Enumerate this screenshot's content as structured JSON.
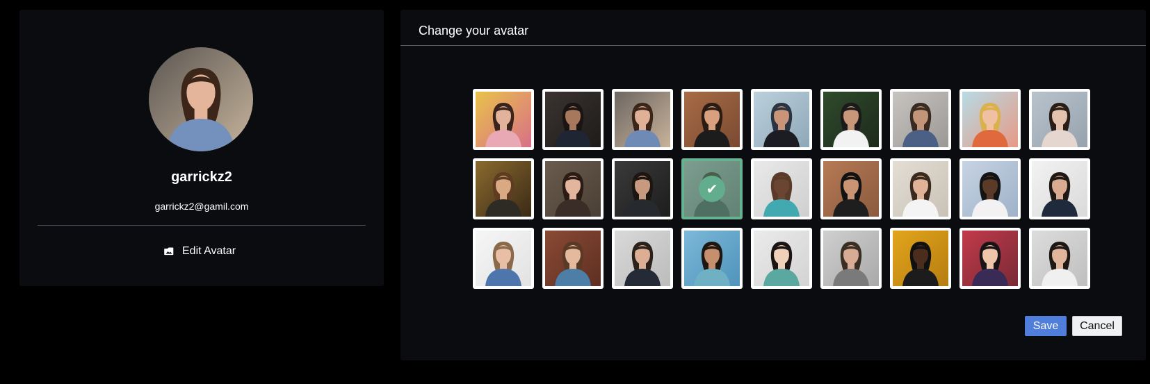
{
  "profile": {
    "username": "garrickz2",
    "email": "garrickz2@gamil.com",
    "edit_avatar_label": "Edit Avatar",
    "edit_avatar_icon": "image-icon"
  },
  "modal": {
    "title": "Change your avatar",
    "save_label": "Save",
    "cancel_label": "Cancel",
    "selected_index": 12,
    "selected_check_glyph": "✔",
    "accent_color": "#68b292",
    "save_color": "#4f7fdb"
  },
  "avatars": [
    {
      "name": "woman-glasses-graffiti",
      "bg": "#e9c24a",
      "bg2": "#d86f88",
      "skin": "#e2b39a",
      "hair": "#3b241b",
      "shirt": "#e8a8b4"
    },
    {
      "name": "man-suit-office",
      "bg": "#3a3431",
      "bg2": "#1e1b19",
      "skin": "#a8785d",
      "hair": "#1a1412",
      "shirt": "#1f2533"
    },
    {
      "name": "woman-denim-cafe",
      "bg": "#6d6662",
      "bg2": "#c8b39a",
      "skin": "#e0b196",
      "hair": "#3c2619",
      "shirt": "#6f8bb5"
    },
    {
      "name": "man-sunglasses-brick",
      "bg": "#a86c46",
      "bg2": "#7a4a32",
      "skin": "#d8a07f",
      "hair": "#2a1b13",
      "shirt": "#1c1c1c"
    },
    {
      "name": "man-cap-smiling",
      "bg": "#bcd0dc",
      "bg2": "#8ea8b8",
      "skin": "#c99478",
      "hair": "#2a3442",
      "shirt": "#1b1d22"
    },
    {
      "name": "man-white-tee-palms",
      "bg": "#2f4a2c",
      "bg2": "#1d2b1b",
      "skin": "#c8977a",
      "hair": "#1a1a1a",
      "shirt": "#f2f2f2"
    },
    {
      "name": "man-striped-shirt",
      "bg": "#c7c4c0",
      "bg2": "#9b9896",
      "skin": "#c29478",
      "hair": "#3a2b22",
      "shirt": "#4c5f85"
    },
    {
      "name": "woman-orange-jacket",
      "bg": "#b7dbe5",
      "bg2": "#e79a86",
      "skin": "#f0c0a2",
      "hair": "#d9b14d",
      "shirt": "#e06a3e"
    },
    {
      "name": "woman-light-dress",
      "bg": "#b8c3cc",
      "bg2": "#96a2ad",
      "skin": "#e3c1ad",
      "hair": "#2a1d18",
      "shirt": "#e5d6cf"
    },
    {
      "name": "woman-glasses-warm",
      "bg": "#8a6a2e",
      "bg2": "#3a2a16",
      "skin": "#d9a984",
      "hair": "#5e3c22",
      "shirt": "#2e2a24"
    },
    {
      "name": "woman-dark-hair-glasses",
      "bg": "#6a5c4e",
      "bg2": "#4a3f35",
      "skin": "#e2b59c",
      "hair": "#2a1c15",
      "shirt": "#3a2c26"
    },
    {
      "name": "man-dark-background",
      "bg": "#3a3a3a",
      "bg2": "#1d1d1d",
      "skin": "#c79a80",
      "hair": "#1c1612",
      "shirt": "#26292e"
    },
    {
      "name": "man-curly-hair-selected",
      "bg": "#8c8c8c",
      "bg2": "#5c5c5c",
      "skin": "#d6a78a",
      "hair": "#2c1c12",
      "shirt": "#3a3a3a"
    },
    {
      "name": "man-bald-smiling",
      "bg": "#e9e9e9",
      "bg2": "#cfcfcf",
      "skin": "#6a4532",
      "hair": "#5a3b2a",
      "shirt": "#42a9b0"
    },
    {
      "name": "man-hat-sunglasses",
      "bg": "#b67a55",
      "bg2": "#8b5a3e",
      "skin": "#c99474",
      "hair": "#121212",
      "shirt": "#1e1e1e"
    },
    {
      "name": "man-beard-white-shirt",
      "bg": "#e3ddd4",
      "bg2": "#c9c2b6",
      "skin": "#e0b398",
      "hair": "#3a2a1e",
      "shirt": "#f4f4f4"
    },
    {
      "name": "man-white-blazer",
      "bg": "#c6d3e3",
      "bg2": "#9fb2c9",
      "skin": "#5c3a28",
      "hair": "#141414",
      "shirt": "#f2f2f2"
    },
    {
      "name": "man-beard-suit",
      "bg": "#f2f2f2",
      "bg2": "#dadada",
      "skin": "#d9ac92",
      "hair": "#1f1915",
      "shirt": "#1f2a3c"
    },
    {
      "name": "man-blue-shirt",
      "bg": "#f6f6f6",
      "bg2": "#e2e2e2",
      "skin": "#e8bfa4",
      "hair": "#8a6a4a",
      "shirt": "#4f75ad"
    },
    {
      "name": "woman-brick-wall",
      "bg": "#8a4a34",
      "bg2": "#5e2f22",
      "skin": "#e5b99e",
      "hair": "#5a3a26",
      "shirt": "#4d7fa6"
    },
    {
      "name": "man-glasses-beard",
      "bg": "#d9d9d9",
      "bg2": "#bcbcbc",
      "skin": "#dcae94",
      "hair": "#2a211b",
      "shirt": "#252b36"
    },
    {
      "name": "man-young-blue-bg",
      "bg": "#7cb8d8",
      "bg2": "#4f94bc",
      "skin": "#c6906f",
      "hair": "#1e1611",
      "shirt": "#6fb0c4"
    },
    {
      "name": "woman-asian-bright",
      "bg": "#ebebeb",
      "bg2": "#d3d3d3",
      "skin": "#efd0b9",
      "hair": "#1a1412",
      "shirt": "#5aa8a0"
    },
    {
      "name": "man-glasses-gray",
      "bg": "#cfcfcf",
      "bg2": "#a9a9a9",
      "skin": "#d8ac94",
      "hair": "#3a2e24",
      "shirt": "#7a7a7a"
    },
    {
      "name": "man-sunglasses-yellow",
      "bg": "#e3a51c",
      "bg2": "#b57d10",
      "skin": "#4a2d1d",
      "hair": "#111111",
      "shirt": "#1c1c1c"
    },
    {
      "name": "woman-glasses-smiling",
      "bg": "#c23a4a",
      "bg2": "#7a2a36",
      "skin": "#f0c6aa",
      "hair": "#1a1416",
      "shirt": "#3a2a56"
    },
    {
      "name": "man-white-shirt-gray",
      "bg": "#dcdcdc",
      "bg2": "#bfbfbf",
      "skin": "#e0b59c",
      "hair": "#1e1814",
      "shirt": "#f0f0f0"
    }
  ],
  "main_avatar": {
    "name": "woman-denim-cafe-large",
    "bg": "#5b5652",
    "bg2": "#c7b49c",
    "skin": "#e4b59a",
    "hair": "#3c2619",
    "shirt": "#7391bc"
  }
}
